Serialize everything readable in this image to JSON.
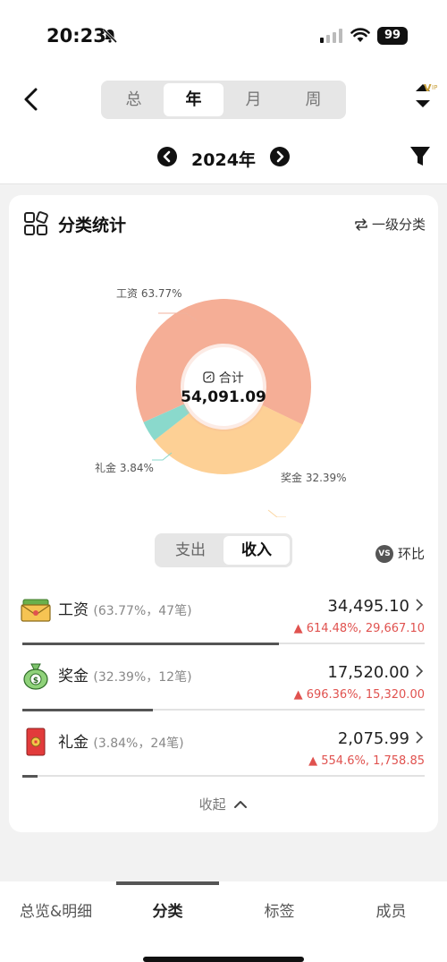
{
  "status": {
    "time": "20:23",
    "battery": "99"
  },
  "period_tabs": [
    {
      "label": "总",
      "active": false
    },
    {
      "label": "年",
      "active": true
    },
    {
      "label": "月",
      "active": false
    },
    {
      "label": "周",
      "active": false
    }
  ],
  "vip_icon": "vip-sort-icon",
  "year": "2024年",
  "card": {
    "title": "分类统计",
    "level_label": "一级分类",
    "center_label": "合计",
    "center_value": "54,091.09",
    "slice_labels": {
      "salary": "工资 63.77%",
      "bonus": "奖金 32.39%",
      "gift": "礼金 3.84%"
    },
    "io_tabs": [
      {
        "label": "支出",
        "active": false
      },
      {
        "label": "收入",
        "active": true
      }
    ],
    "vs_badge": "VS",
    "vs_label": "环比",
    "collapse_label": "收起"
  },
  "donut": {
    "slices": [
      {
        "name": "工资",
        "percent": 63.77,
        "color": "#f5ae96"
      },
      {
        "name": "奖金",
        "percent": 32.39,
        "color": "#fdd095"
      },
      {
        "name": "礼金",
        "percent": 3.84,
        "color": "#8ad9cc"
      }
    ]
  },
  "items": [
    {
      "name": "工资",
      "meta": "(63.77%，47笔)",
      "amount": "34,495.10",
      "change": "614.48%, 29,667.10",
      "ratio": 0.6377,
      "icon": "salary-envelope-icon"
    },
    {
      "name": "奖金",
      "meta": "(32.39%，12笔)",
      "amount": "17,520.00",
      "change": "696.36%, 15,320.00",
      "ratio": 0.3239,
      "icon": "money-bag-icon"
    },
    {
      "name": "礼金",
      "meta": "(3.84%，24笔)",
      "amount": "2,075.99",
      "change": "554.6%, 1,758.85",
      "ratio": 0.0384,
      "icon": "red-envelope-icon"
    }
  ],
  "tabbar": [
    {
      "label": "总览&明细",
      "active": false
    },
    {
      "label": "分类",
      "active": true
    },
    {
      "label": "标签",
      "active": false
    },
    {
      "label": "成员",
      "active": false
    }
  ],
  "colors": {
    "accent_up": "#e0524f",
    "bar": "#555555"
  }
}
